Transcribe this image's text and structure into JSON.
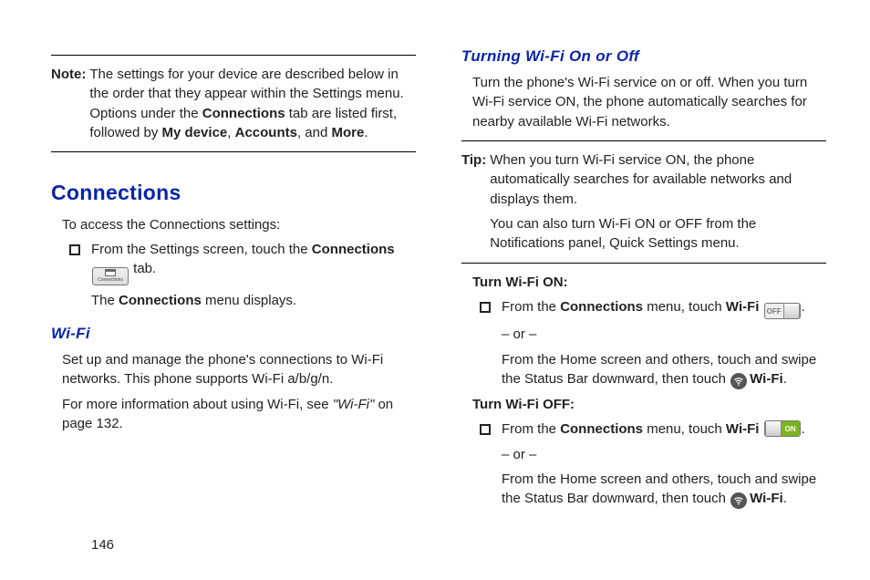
{
  "page_number": "146",
  "left": {
    "note_label": "Note:",
    "note_pre": "The settings for your device are described below in the order that they appear within the Settings menu. Options under the ",
    "note_b1": "Connections",
    "note_mid1": " tab are listed first, followed by ",
    "note_b2": "My device",
    "note_sep1": ", ",
    "note_b3": "Accounts",
    "note_sep2": ", and ",
    "note_b4": "More",
    "note_post": ".",
    "h2": "Connections",
    "p_access": "To access the Connections settings:",
    "bullet_pre": "From the Settings screen, touch the ",
    "bullet_b": "Connections",
    "bullet_post": " tab.",
    "menu_pre": "The ",
    "menu_b": "Connections",
    "menu_post": " menu displays.",
    "h3": "Wi-Fi",
    "wifi_p1": "Set up and manage the phone's connections to Wi-Fi networks. This phone supports Wi-Fi a/b/g/n.",
    "wifi_p2_pre": "For more information about using Wi-Fi, see ",
    "wifi_ref": "\"Wi-Fi\"",
    "wifi_p2_post": " on page 132.",
    "chip_label": "Connections"
  },
  "right": {
    "h3": "Turning Wi-Fi On or Off",
    "p_intro": "Turn the phone's Wi-Fi service on or off. When you turn Wi-Fi service ON, the phone automatically searches for nearby available Wi-Fi networks.",
    "tip_label": "Tip:",
    "tip_p1": "When you turn Wi-Fi service ON, the phone automatically searches for available networks and displays them.",
    "tip_p2": "You can also turn Wi-Fi ON or OFF from the Notifications panel, Quick Settings menu.",
    "on_h": "Turn Wi-Fi ON:",
    "on_b_pre": "From the ",
    "on_b_b1": "Connections",
    "on_b_mid": " menu, touch ",
    "on_b_b2": "Wi-Fi",
    "or": "– or –",
    "swipe_pre": "From the Home screen and others, touch and swipe the Status Bar downward, then touch ",
    "swipe_b": "Wi-Fi",
    "off_h": "Turn Wi-Fi OFF:",
    "toggle_off": "OFF",
    "toggle_on": "ON"
  }
}
